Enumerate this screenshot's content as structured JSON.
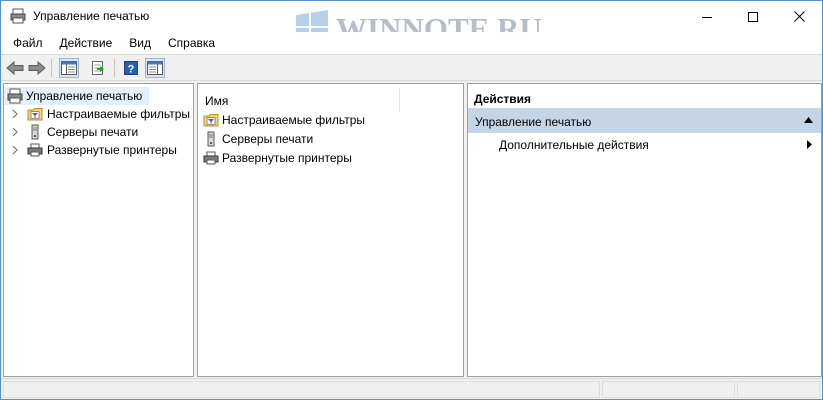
{
  "window": {
    "title": "Управление печатью",
    "watermark": "WINNOTE.RU"
  },
  "menubar": {
    "items": [
      "Файл",
      "Действие",
      "Вид",
      "Справка"
    ]
  },
  "toolbar": {
    "buttons": [
      "back-arrow-icon",
      "forward-arrow-icon",
      "show-hide-tree-icon",
      "export-list-icon",
      "help-icon",
      "show-hide-action-pane-icon"
    ]
  },
  "tree": {
    "root": "Управление печатью",
    "items": [
      {
        "label": "Настраиваемые фильтры",
        "icon": "filter-folder-icon"
      },
      {
        "label": "Серверы печати",
        "icon": "server-icon"
      },
      {
        "label": "Развернутые принтеры",
        "icon": "printer-icon"
      }
    ]
  },
  "list": {
    "column": "Имя",
    "items": [
      {
        "label": "Настраиваемые фильтры",
        "icon": "filter-folder-icon"
      },
      {
        "label": "Серверы печати",
        "icon": "server-icon"
      },
      {
        "label": "Развернутые принтеры",
        "icon": "printer-icon"
      }
    ]
  },
  "actions": {
    "header": "Действия",
    "section": "Управление печатью",
    "more": "Дополнительные действия"
  },
  "colors": {
    "selection": "#c4d5e8",
    "window_border": "#5b8fc7"
  }
}
